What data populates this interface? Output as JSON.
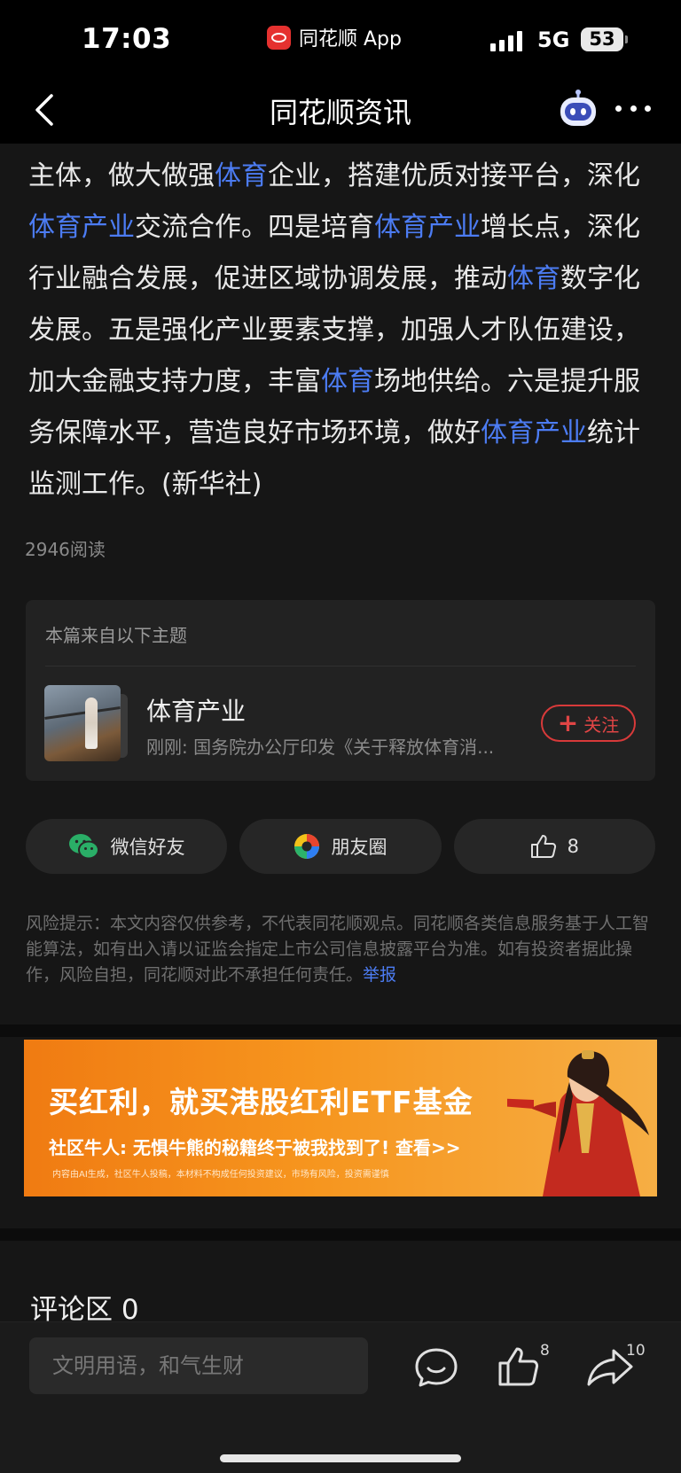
{
  "status_bar": {
    "time": "17:03",
    "app_label": "同花顺 App",
    "network": "5G",
    "battery": "53"
  },
  "nav": {
    "title": "同花顺资讯",
    "back_icon": "back-arrow-icon",
    "assistant_icon": "robot-assistant-icon",
    "more_icon": "more-dots-icon"
  },
  "article": {
    "segments": [
      {
        "text": "主体，做大做强",
        "highlight": false
      },
      {
        "text": "体育",
        "highlight": true
      },
      {
        "text": "企业，搭建优质对接平台，深化",
        "highlight": false
      },
      {
        "text": "体育产业",
        "highlight": true
      },
      {
        "text": "交流合作。四是培育",
        "highlight": false
      },
      {
        "text": "体育产业",
        "highlight": true
      },
      {
        "text": "增长点，深化行业融合发展，促进区域协调发展，推动",
        "highlight": false
      },
      {
        "text": "体育",
        "highlight": true
      },
      {
        "text": "数字化发展。五是强化产业要素支撑，加强人才队伍建设，加大金融支持力度，丰富",
        "highlight": false
      },
      {
        "text": "体育",
        "highlight": true
      },
      {
        "text": "场地供给。六是提升服务保障水平，营造良好市场环境，做好",
        "highlight": false
      },
      {
        "text": "体育产业",
        "highlight": true
      },
      {
        "text": "统计监测工作。(新华社)",
        "highlight": false
      }
    ],
    "read_count": "2946阅读"
  },
  "topic": {
    "header": "本篇来自以下主题",
    "name": "体育产业",
    "latest": "刚刚: 国务院办公厅印发《关于释放体育消...",
    "follow_label": "关注"
  },
  "share": {
    "wechat_label": "微信好友",
    "moments_label": "朋友圈",
    "like_count": "8"
  },
  "disclaimer": {
    "text": "风险提示：本文内容仅供参考，不代表同花顺观点。同花顺各类信息服务基于人工智能算法，如有出入请以证监会指定上市公司信息披露平台为准。如有投资者据此操作，风险自担，同花顺对此不承担任何责任。",
    "report_label": "举报"
  },
  "ad_banner": {
    "title": "买红利，就买港股红利ETF基金",
    "subtitle": "社区牛人: 无惧牛熊的秘籍终于被我找到了! 查看>>",
    "fine_print": "内容由AI生成，社区牛人投稿，本材料不构成任何投资建议，市场有风险，投资需谨慎"
  },
  "comments": {
    "title": "评论区 0"
  },
  "bottom_bar": {
    "input_placeholder": "文明用语，和气生财",
    "like_count": "8",
    "share_count": "10"
  },
  "colors": {
    "highlight": "#4c7cf3",
    "follow_red": "#d83a3a",
    "ad_orange": "#f07b12"
  }
}
